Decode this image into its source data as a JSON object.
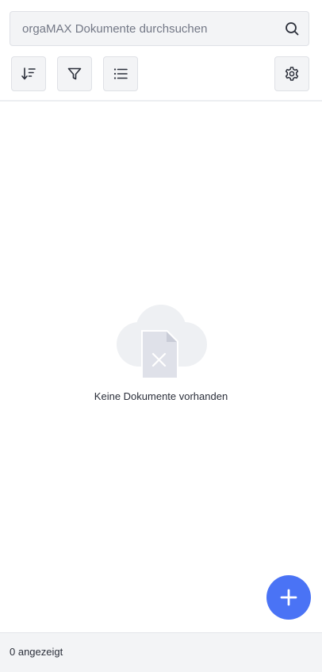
{
  "search": {
    "placeholder": "orgaMAX Dokumente durchsuchen",
    "value": "",
    "icon": "search-icon"
  },
  "toolbar": {
    "sort_icon": "sort-descending-icon",
    "filter_icon": "filter-icon",
    "list_icon": "list-view-icon",
    "settings_icon": "gear-icon"
  },
  "empty_state": {
    "message": "Keine Dokumente vorhanden",
    "icon": "empty-documents-icon"
  },
  "fab": {
    "icon": "plus-icon",
    "color": "#4a73f5"
  },
  "footer": {
    "count_text": "0 angezeigt"
  },
  "colors": {
    "accent": "#4a73f5",
    "surface": "#f3f4f6",
    "border": "#dfe1e6",
    "text": "#2b2f3a",
    "placeholder": "#737886"
  }
}
